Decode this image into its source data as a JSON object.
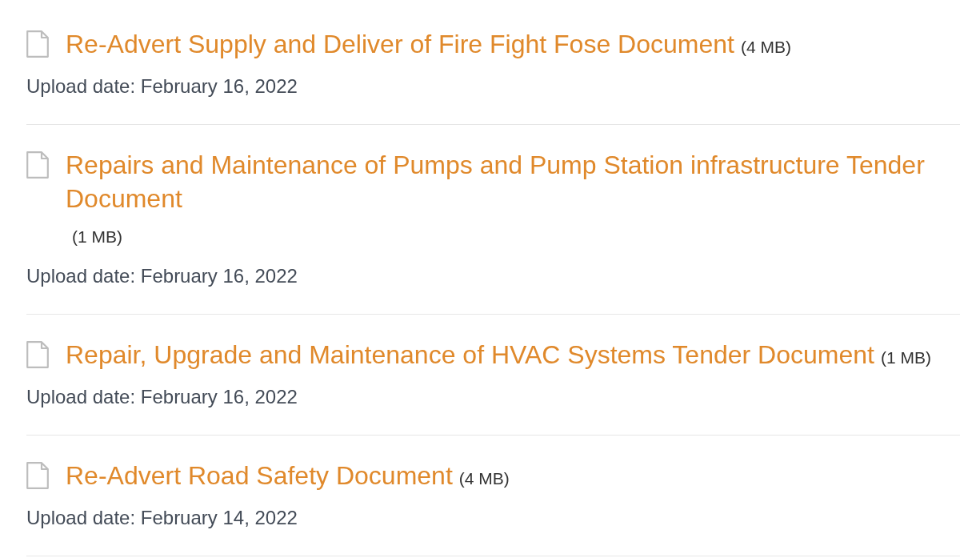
{
  "documents": [
    {
      "title": "Re-Advert Supply and Deliver of Fire Fight Fose Document",
      "size": "(4 MB)",
      "upload_date": "Upload date: February 16, 2022"
    },
    {
      "title": "Repairs and Maintenance of Pumps and Pump Station infrastructure Tender Document",
      "size": "(1 MB)",
      "upload_date": "Upload date: February 16, 2022"
    },
    {
      "title": "Repair, Upgrade and Maintenance of HVAC Systems Tender Document",
      "size": "(1 MB)",
      "upload_date": "Upload date: February 16, 2022"
    },
    {
      "title": "Re-Advert Road Safety Document",
      "size": "(4 MB)",
      "upload_date": "Upload date: February 14, 2022"
    }
  ]
}
